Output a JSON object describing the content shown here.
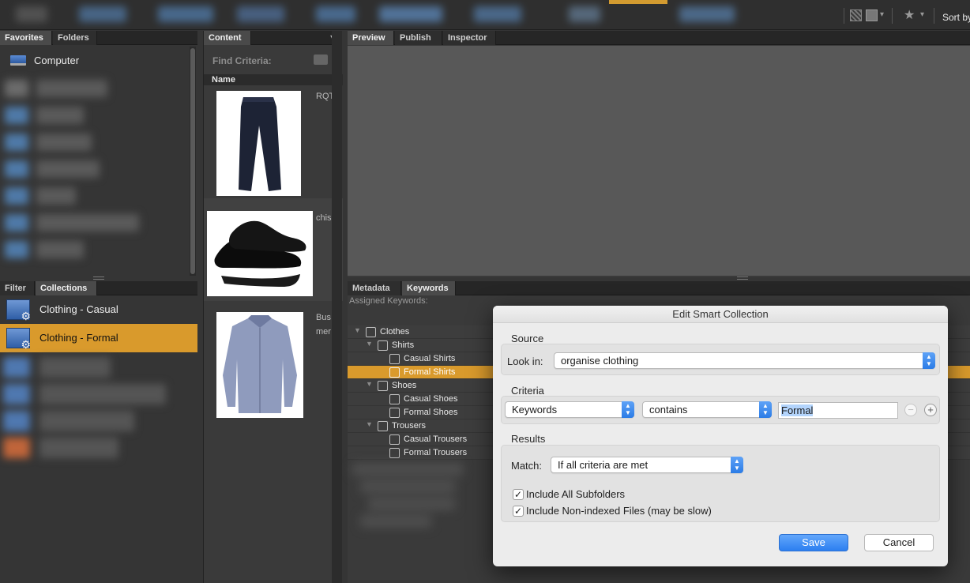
{
  "toolbar": {
    "sort_label": "Sort by",
    "icons": [
      "grid-view-icon",
      "square-view-icon",
      "star-filter-icon"
    ]
  },
  "favorites_panel": {
    "tabs": [
      "Favorites",
      "Folders"
    ],
    "items": [
      {
        "label": "Computer",
        "icon": "computer-icon"
      }
    ]
  },
  "collections_panel": {
    "tabs": [
      "Filter",
      "Collections"
    ],
    "items": [
      {
        "label": "Clothing - Casual",
        "icon": "smart-collection-icon",
        "selected": false
      },
      {
        "label": "Clothing - Formal",
        "icon": "smart-collection-icon",
        "selected": true
      }
    ]
  },
  "content_panel": {
    "tab": "Content",
    "find_criteria_label": "Find Criteria:",
    "column_name": "Name",
    "items": [
      {
        "thumb": "trousers",
        "text_lines": [
          "RQT"
        ]
      },
      {
        "thumb": "shoes",
        "text_lines": [
          "chis"
        ]
      },
      {
        "thumb": "shirt",
        "text_lines": [
          "Bus",
          "mer"
        ]
      }
    ]
  },
  "preview_panel": {
    "tabs": [
      "Preview",
      "Publish",
      "Inspector"
    ]
  },
  "keywords_panel": {
    "tabs": [
      "Metadata",
      "Keywords"
    ],
    "assigned_label": "Assigned Keywords:",
    "tree": [
      {
        "label": "Clothes",
        "level": 0,
        "expanded": true,
        "selected": false
      },
      {
        "label": "Shirts",
        "level": 1,
        "expanded": true,
        "selected": false
      },
      {
        "label": "Casual Shirts",
        "level": 2,
        "selected": false
      },
      {
        "label": "Formal Shirts",
        "level": 2,
        "selected": true
      },
      {
        "label": "Shoes",
        "level": 1,
        "expanded": true,
        "selected": false
      },
      {
        "label": "Casual Shoes",
        "level": 2,
        "selected": false
      },
      {
        "label": "Formal Shoes",
        "level": 2,
        "selected": false
      },
      {
        "label": "Trousers",
        "level": 1,
        "expanded": true,
        "selected": false
      },
      {
        "label": "Casual Trousers",
        "level": 2,
        "selected": false
      },
      {
        "label": "Formal Trousers",
        "level": 2,
        "selected": false
      }
    ]
  },
  "dialog": {
    "title": "Edit Smart Collection",
    "source": {
      "heading": "Source",
      "look_in_label": "Look in:",
      "look_in_value": "organise clothing"
    },
    "criteria": {
      "heading": "Criteria",
      "field": "Keywords",
      "operator": "contains",
      "value": "Formal",
      "remove_symbol": "−",
      "add_symbol": "+"
    },
    "results": {
      "heading": "Results",
      "match_label": "Match:",
      "match_value": "If all criteria are met",
      "include_subfolders_label": "Include All Subfolders",
      "include_subfolders_checked": true,
      "include_nonindexed_label": "Include Non-indexed Files (may be slow)",
      "include_nonindexed_checked": true
    },
    "save_label": "Save",
    "cancel_label": "Cancel"
  },
  "colors": {
    "accent": "#d99a2c",
    "panel_bg": "#3a3a3a",
    "preview_bg": "#585858",
    "primary_button": "#2c7ff0"
  }
}
